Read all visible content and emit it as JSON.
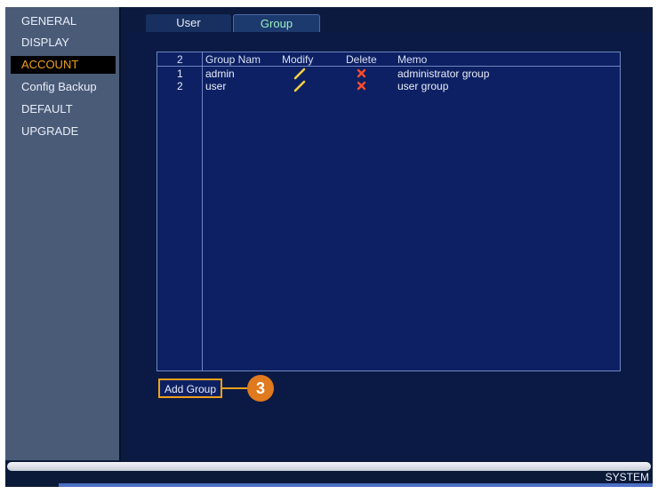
{
  "sidebar": {
    "items": [
      {
        "label": "GENERAL",
        "active": false
      },
      {
        "label": "DISPLAY",
        "active": false
      },
      {
        "label": "ACCOUNT",
        "active": true
      },
      {
        "label": "Config Backup",
        "active": false
      },
      {
        "label": "DEFAULT",
        "active": false
      },
      {
        "label": "UPGRADE",
        "active": false
      }
    ]
  },
  "tabs": [
    {
      "label": "User",
      "active": false
    },
    {
      "label": "Group",
      "active": true
    }
  ],
  "table": {
    "count": "2",
    "headers": [
      "Group Nam",
      "Modify",
      "Delete",
      "Memo"
    ],
    "rows": [
      {
        "index": "1",
        "name": "admin",
        "memo": "administrator group"
      },
      {
        "index": "2",
        "name": "user",
        "memo": "user group"
      }
    ]
  },
  "actions": {
    "add_group": "Add Group"
  },
  "callout": {
    "number": "3"
  },
  "footer": {
    "system": "SYSTEM"
  },
  "colors": {
    "accent": "#f0a11a",
    "active_tab_text": "#9bf0c0",
    "delete_icon": "#ff4d2e",
    "modify_icon": "#f4d03f"
  },
  "icons": {
    "modify": "pencil-icon",
    "delete": "x-icon"
  }
}
